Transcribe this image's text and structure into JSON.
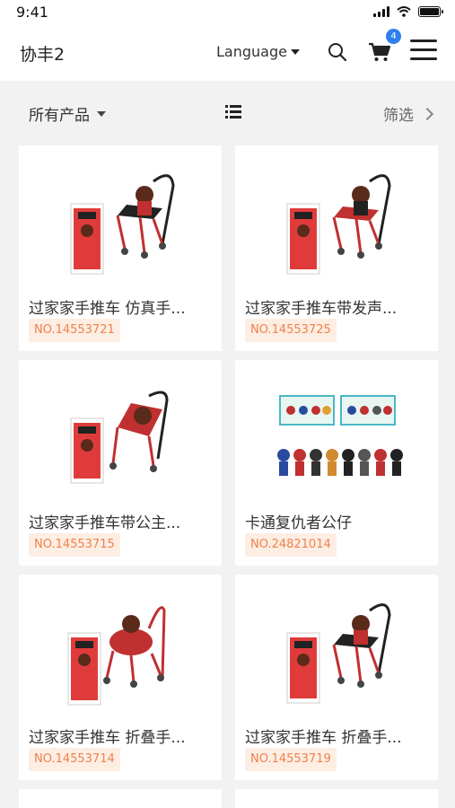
{
  "status": {
    "time": "9:41"
  },
  "header": {
    "brand": "协丰2",
    "language_label": "Language",
    "cart_count": "4"
  },
  "toolbar": {
    "category_label": "所有产品",
    "filter_label": "筛选"
  },
  "products": [
    {
      "title": "过家家手推车 仿真手...",
      "code": "NO.14553721",
      "image": "stroller-black-seat"
    },
    {
      "title": "过家家手推车带发声...",
      "code": "NO.14553725",
      "image": "stroller-black-seat"
    },
    {
      "title": "过家家手推车带公主...",
      "code": "NO.14553715",
      "image": "stroller-red"
    },
    {
      "title": "卡通复仇者公仔",
      "code": "NO.24821014",
      "image": "avengers-figures"
    },
    {
      "title": "过家家手推车 折叠手...",
      "code": "NO.14553714",
      "image": "stroller-round"
    },
    {
      "title": "过家家手推车 折叠手...",
      "code": "NO.14553719",
      "image": "stroller-black-seat"
    }
  ]
}
